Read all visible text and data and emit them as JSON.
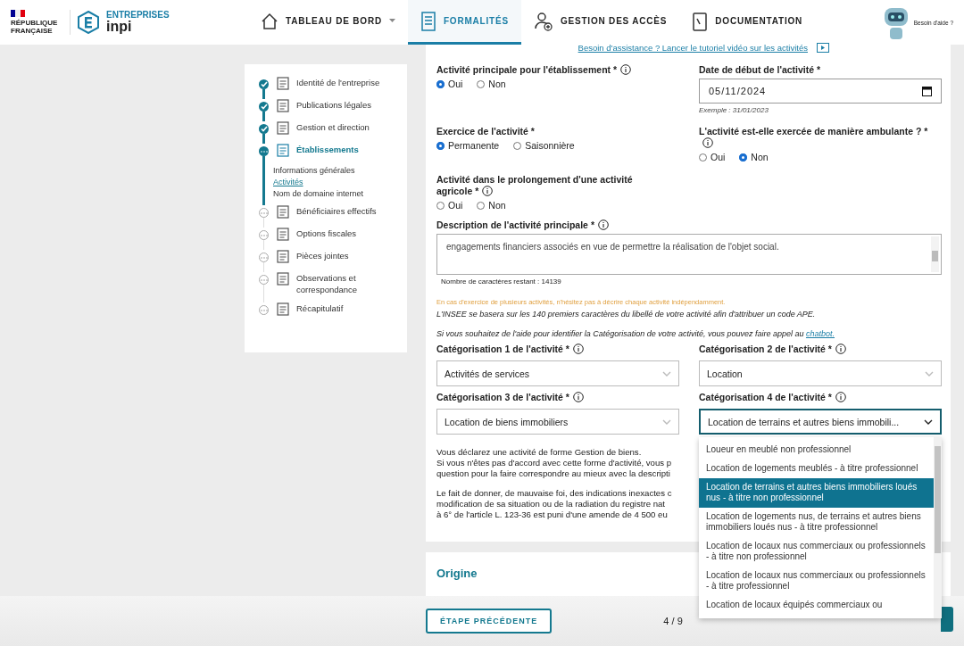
{
  "header": {
    "republic": "RÉPUBLIQUE FRANÇAISE",
    "brand_top": "ENTREPRISES",
    "brand": "inpi",
    "nav": [
      {
        "label": "TABLEAU DE BORD",
        "selected": false,
        "has_menu": true
      },
      {
        "label": "FORMALITÉS",
        "selected": true,
        "has_menu": false
      },
      {
        "label": "GESTION DES ACCÈS",
        "selected": false,
        "has_menu": false
      },
      {
        "label": "DOCUMENTATION",
        "selected": false,
        "has_menu": false
      }
    ],
    "help": "Besoin d'aide ?"
  },
  "steps": [
    {
      "label": "Identité de l'entreprise",
      "done": true,
      "current": false
    },
    {
      "label": "Publications légales",
      "done": true,
      "current": false
    },
    {
      "label": "Gestion et direction",
      "done": true,
      "current": false
    },
    {
      "label": "Établissements",
      "done": false,
      "current": true,
      "children": [
        {
          "label": "Informations générales",
          "selected": false
        },
        {
          "label": "Activités",
          "selected": true
        },
        {
          "label": "Nom de domaine internet",
          "selected": false
        }
      ]
    },
    {
      "label": "Bénéficiaires effectifs",
      "done": false,
      "current": false
    },
    {
      "label": "Options fiscales",
      "done": false,
      "current": false
    },
    {
      "label": "Pièces jointes",
      "done": false,
      "current": false
    },
    {
      "label": "Observations et correspondance",
      "done": false,
      "current": false
    },
    {
      "label": "Récapitulatif",
      "done": false,
      "current": false
    }
  ],
  "tutorial_link": "Besoin d'assistance ? Lancer le tutoriel vidéo sur les activités",
  "main_activity": {
    "label": "Activité principale pour l'établissement *",
    "options": [
      {
        "label": "Oui",
        "selected": true
      },
      {
        "label": "Non",
        "selected": false
      }
    ]
  },
  "start_date": {
    "label": "Date de début de l'activité *",
    "value": "05/11/2024",
    "hint": "Exemple : 31/01/2023"
  },
  "exercise": {
    "label": "Exercice de l'activité *",
    "options": [
      {
        "label": "Permanente",
        "selected": true
      },
      {
        "label": "Saisonnière",
        "selected": false
      }
    ]
  },
  "ambulant": {
    "label": "L'activité est-elle exercée de manière ambulante ? *",
    "options": [
      {
        "label": "Oui",
        "selected": false
      },
      {
        "label": "Non",
        "selected": true
      }
    ]
  },
  "agricultural": {
    "label_lines": [
      "Activité dans le prolongement d'une activité",
      "agricole *"
    ],
    "options": [
      {
        "label": "Oui",
        "selected": false
      },
      {
        "label": "Non",
        "selected": false
      }
    ]
  },
  "description": {
    "label": "Description de l'activité principale *",
    "value": "engagements financiers associés en vue de permettre la réalisation de l'objet social.",
    "counter": "Nombre de caractères restant : 14139"
  },
  "warning": "En cas d'exercice de plusieurs activités, n'hésitez pas à décrire chaque activité indépendamment.",
  "insee_note": "L'INSEE se basera sur les 140 premiers caractères du libellé de votre activité afin d'attribuer un code APE.",
  "chatbot_note": {
    "text": "Si vous souhaitez de l'aide pour identifier la Catégorisation de votre activité, vous pouvez faire appel au",
    "link": "chatbot."
  },
  "categories": [
    {
      "label": "Catégorisation 1 de l'activité *",
      "value": "Activités de services",
      "open": false
    },
    {
      "label": "Catégorisation 2 de l'activité *",
      "value": "Location",
      "open": false
    },
    {
      "label": "Catégorisation 3 de l'activité *",
      "value": "Location de biens immobiliers",
      "open": false
    },
    {
      "label": "Catégorisation 4 de l'activité *",
      "value": "Location de terrains et autres biens immobili...",
      "open": true
    }
  ],
  "dropdown_options": [
    {
      "label": "Loueur en meublé non professionnel",
      "selected": false
    },
    {
      "label": "Location de logements meublés - à titre professionnel",
      "selected": false
    },
    {
      "label": "Location de terrains et autres biens immobiliers loués nus - à titre non professionnel",
      "selected": true
    },
    {
      "label": "Location de logements nus, de terrains et autres biens immobiliers loués nus - à titre professionnel",
      "selected": false
    },
    {
      "label": "Location de locaux nus commerciaux ou professionnels - à titre non professionnel",
      "selected": false
    },
    {
      "label": "Location de locaux nus commerciaux ou professionnels - à titre professionnel",
      "selected": false
    },
    {
      "label": "Location de locaux équipés commerciaux ou",
      "selected": false
    }
  ],
  "declaration_lines": [
    "Vous déclarez une activité de forme Gestion de biens.",
    "Si vous n'êtes pas d'accord avec cette forme d'activité, vous p",
    "question pour la faire correspondre au mieux avec la descripti"
  ],
  "penalty_lines": [
    "Le fait de donner, de mauvaise foi, des indications inexactes c",
    "modification de sa situation ou de la radiation du registre nat",
    "à 6° de l'article L. 123-36 est puni d'une amende de 4 500 eu"
  ],
  "origin_title": "Origine",
  "footer": {
    "previous": "ÉTAPE PRÉCÉDENTE",
    "progress": "4 / 9"
  }
}
